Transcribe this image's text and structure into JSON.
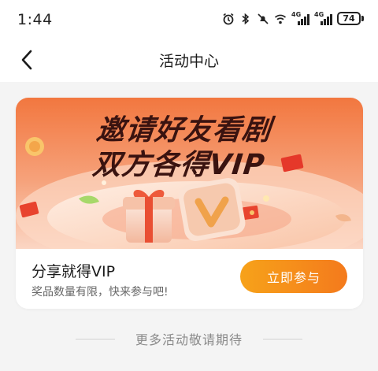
{
  "statusbar": {
    "time": "1:44",
    "icons": [
      "alarm-icon",
      "bluetooth-icon",
      "mute-icon",
      "wifi-icon",
      "signal-4g-icon",
      "signal-4g-icon"
    ],
    "signal_label_1": "4G",
    "signal_label_2": "4G",
    "battery": "74"
  },
  "navbar": {
    "back_icon": "chevron-left-icon",
    "title": "活动中心"
  },
  "activity_card": {
    "banner_line1": "邀请好友看剧",
    "banner_line2": "双方各得VIP",
    "title": "分享就得VIP",
    "subtitle": "奖品数量有限，快来参与吧!",
    "button_label": "立即参与",
    "accent_colors": [
      "#f7a21a",
      "#f47a1c"
    ]
  },
  "footer": {
    "more_text": "更多活动敬请期待"
  }
}
